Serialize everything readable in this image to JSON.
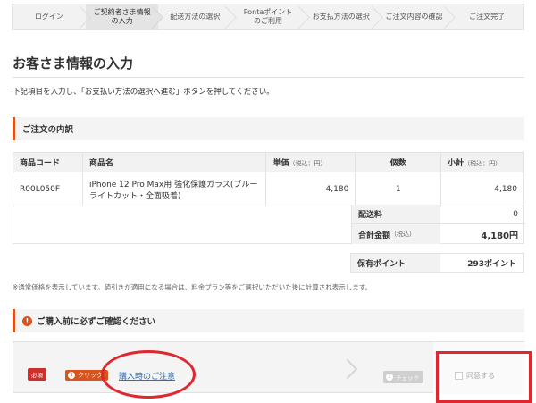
{
  "stepper": [
    {
      "label": "ログイン",
      "active": false
    },
    {
      "label": "ご契約者さま情報\nの入力",
      "active": true
    },
    {
      "label": "配送方法の選択",
      "active": false
    },
    {
      "label": "Pontaポイント\nのご利用",
      "active": false
    },
    {
      "label": "お支払方法の選択",
      "active": false
    },
    {
      "label": "ご注文内容の確認",
      "active": false
    },
    {
      "label": "ご注文完了",
      "active": false
    }
  ],
  "page": {
    "title": "お客さま情報の入力",
    "lead": "下記項目を入力し、「お支払い方法の選択へ進む」ボタンを押してください。"
  },
  "order": {
    "heading": "ご注文の内訳",
    "columns": {
      "code": "商品コード",
      "name": "商品名",
      "unit": "単価",
      "unit_tax": "（税込：円）",
      "qty": "個数",
      "subtotal": "小計",
      "subtotal_tax": "（税込：円）"
    },
    "rows": [
      {
        "code": "R00L050F",
        "name": "iPhone 12 Pro Max用 強化保護ガラス(ブルーライトカット・全面吸着)",
        "unit": "4,180",
        "qty": "1",
        "subtotal": "4,180"
      }
    ],
    "shipping_label": "配送料",
    "shipping_value": "0",
    "total_label": "合計金額",
    "total_tax": "（税込）",
    "total_value": "4,180円",
    "points_label": "保有ポイント",
    "points_value": "293ポイント",
    "note": "※通常価格を表示しています。値引きが適用になる場合は、料金プラン等をご選択いただいた後に計算され表示します。"
  },
  "confirm": {
    "heading": "ご購入前に必ずご確認ください",
    "required": "必須",
    "click_tag": "クリック",
    "notice_link": "購入時のご注意",
    "check_tag": "チェック",
    "agree_label": "同意する"
  },
  "colors": {
    "accent": "#d9531e",
    "highlight": "#e0262e",
    "link": "#2a6ebb"
  }
}
